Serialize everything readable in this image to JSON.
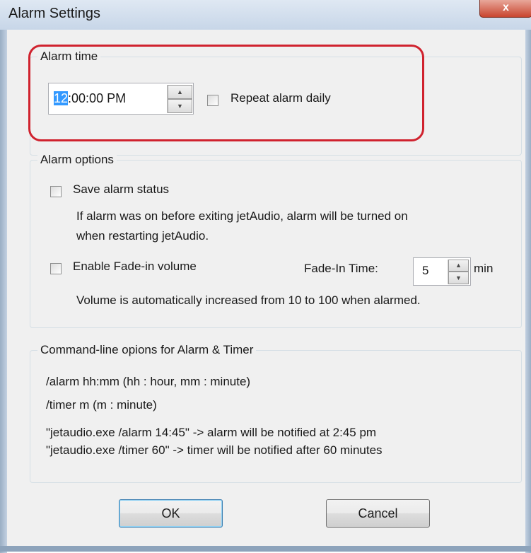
{
  "window": {
    "title": "Alarm Settings",
    "close_label": "x"
  },
  "alarm_time": {
    "group_title": "Alarm time",
    "time_hour": "12",
    "time_rest": ":00:00 PM",
    "repeat_label": "Repeat alarm daily",
    "repeat_checked": false
  },
  "alarm_options": {
    "group_title": "Alarm options",
    "save_status_label": "Save alarm status",
    "save_status_checked": false,
    "save_status_desc_line1": "If alarm was on before exiting jetAudio, alarm will be turned on",
    "save_status_desc_line2": "when restarting jetAudio.",
    "fade_label": "Enable Fade-in volume",
    "fade_checked": false,
    "fade_time_label": "Fade-In Time:",
    "fade_time_value": "5",
    "fade_time_unit": "min",
    "fade_desc": "Volume is automatically increased from 10 to 100 when alarmed."
  },
  "cmdline": {
    "group_title": "Command-line opions for Alarm & Timer",
    "line1": "/alarm hh:mm (hh : hour, mm : minute)",
    "line2": "/timer m (m : minute)",
    "example1": "\"jetaudio.exe /alarm 14:45\" -> alarm will be notified at 2:45 pm",
    "example2": "\"jetaudio.exe /timer 60\" -> timer will be notified after 60 minutes"
  },
  "buttons": {
    "ok_label": "OK",
    "cancel_label": "Cancel"
  },
  "colors": {
    "highlight": "#d0222e",
    "selection": "#3399ff"
  },
  "icons": {
    "spin_up": "up-arrow",
    "spin_down": "down-arrow"
  }
}
